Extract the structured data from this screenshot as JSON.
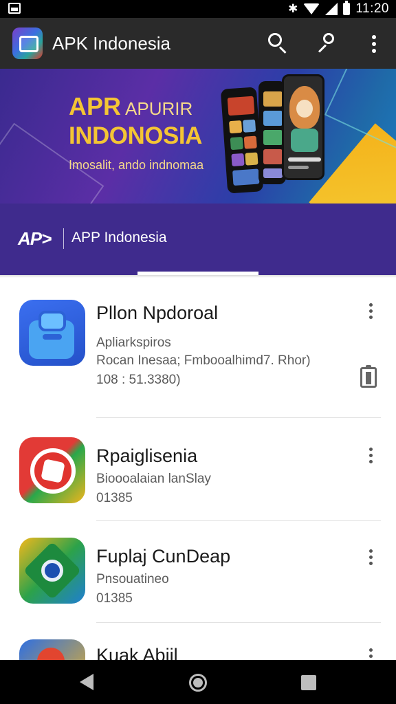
{
  "status_bar": {
    "time": "11:20",
    "bluetooth_glyph": "✱"
  },
  "app_bar": {
    "title": "APK Indonesia"
  },
  "hero": {
    "headline": "APR",
    "headline_thin": "APURIR",
    "subhead": "INDONOSIA",
    "tagline": "Imosalit, ando indnomaa"
  },
  "tabs": {
    "logo": "AP>",
    "label": "APP Indonesia"
  },
  "apps": [
    {
      "name": "Pllon Npdoroal",
      "line1": "Apliarkspiros",
      "line2": "Rocan Inesaa; Fmbooalhimd7. Rhor)",
      "line3": "108 : 51.3380)"
    },
    {
      "name": "Rpaiglisenia",
      "line1": "Bioooalaian lanSlay",
      "line2": "01385"
    },
    {
      "name": "Fuplaj CunDeap",
      "line1": "Pnsouatineo",
      "line2": "01385"
    },
    {
      "name": "Kuak Abiil"
    }
  ],
  "icons": [
    "app-logo-icon",
    "search-icon",
    "key-icon",
    "more-vert-icon",
    "clipboard-icon",
    "back-icon",
    "home-icon",
    "recents-icon"
  ]
}
